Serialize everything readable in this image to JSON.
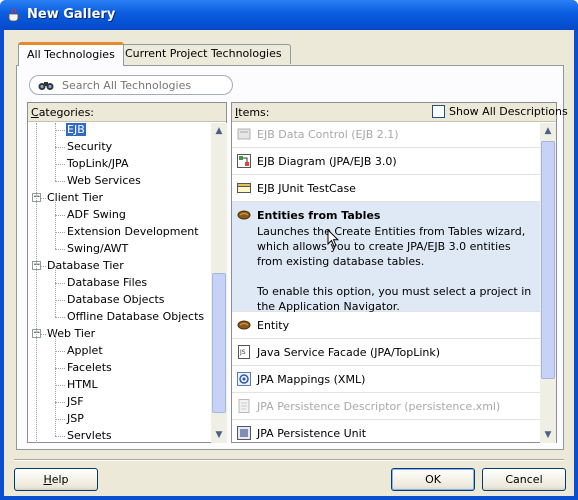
{
  "window": {
    "title": "New Gallery"
  },
  "tabs": [
    "All Technologies",
    "Current Project Technologies"
  ],
  "search": {
    "placeholder": "Search All Technologies"
  },
  "categories": {
    "label_prefix": "",
    "label_mnemonic": "C",
    "label_rest": "ategories:",
    "rows": [
      {
        "label": "EJB",
        "level": 2,
        "selected": true
      },
      {
        "label": "Security",
        "level": 2
      },
      {
        "label": "TopLink/JPA",
        "level": 2
      },
      {
        "label": "Web Services",
        "level": 2
      },
      {
        "label": "Client Tier",
        "level": 1,
        "expanded": true
      },
      {
        "label": "ADF Swing",
        "level": 2
      },
      {
        "label": "Extension Development",
        "level": 2
      },
      {
        "label": "Swing/AWT",
        "level": 2
      },
      {
        "label": "Database Tier",
        "level": 1,
        "expanded": true
      },
      {
        "label": "Database Files",
        "level": 2
      },
      {
        "label": "Database Objects",
        "level": 2
      },
      {
        "label": "Offline Database Objects",
        "level": 2
      },
      {
        "label": "Web Tier",
        "level": 1,
        "expanded": true
      },
      {
        "label": "Applet",
        "level": 2
      },
      {
        "label": "Facelets",
        "level": 2
      },
      {
        "label": "HTML",
        "level": 2
      },
      {
        "label": "JSF",
        "level": 2
      },
      {
        "label": "JSP",
        "level": 2
      },
      {
        "label": "Servlets",
        "level": 2
      }
    ]
  },
  "items": {
    "label_mnemonic": "I",
    "label_rest": "tems:",
    "show_all_label": "Show All Descriptions",
    "list": [
      {
        "name": "EJB Data Control (EJB 2.1)",
        "icon": "ejb-data-control-icon",
        "disabled": true
      },
      {
        "name": "EJB Diagram (JPA/EJB 3.0)",
        "icon": "diagram-icon"
      },
      {
        "name": "EJB JUnit TestCase",
        "icon": "testcase-icon"
      },
      {
        "name": "Entities from Tables",
        "icon": "bean-icon",
        "selected": true,
        "desc1": "Launches the Create Entities from Tables wizard, which allows you to create JPA/EJB 3.0 entities from existing database tables.",
        "desc2": "To enable this option, you must select a project in the Application Navigator."
      },
      {
        "name": "Entity",
        "icon": "bean-icon"
      },
      {
        "name": "Java Service Facade (JPA/TopLink)",
        "icon": "facade-icon"
      },
      {
        "name": "JPA Mappings (XML)",
        "icon": "xml-mapping-icon"
      },
      {
        "name": "JPA Persistence Descriptor (persistence.xml)",
        "icon": "descriptor-icon",
        "disabled": true
      },
      {
        "name": "JPA Persistence Unit",
        "icon": "persistence-unit-icon"
      }
    ]
  },
  "buttons": {
    "help_mnemonic": "H",
    "help_rest": "elp",
    "ok": "OK",
    "cancel": "Cancel"
  },
  "colors": {
    "selection": "#316ac5",
    "selected_item_bg": "#dfe9f5",
    "titlebar": "#0a5ce0"
  }
}
